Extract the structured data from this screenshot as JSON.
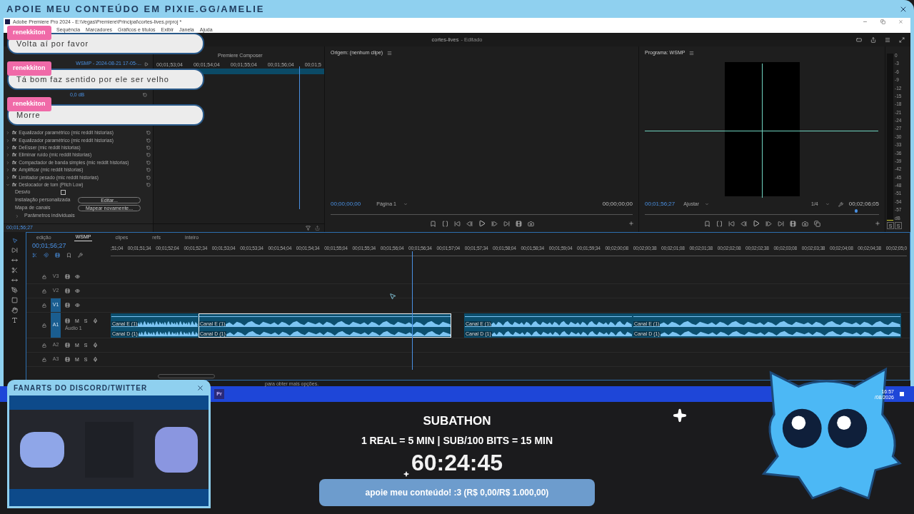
{
  "banner": {
    "title": "APOIE MEU CONTEÚDO EM PIXIE.GG/AMELIE"
  },
  "chat": [
    {
      "user": "renekkiton",
      "text": "Volta aí por favor"
    },
    {
      "user": "renekkiton",
      "text": "Tá bom faz sentido por ele ser velho"
    },
    {
      "user": "renekkiton",
      "text": "Morre"
    }
  ],
  "premiere": {
    "title": "Adobe Premiere Pro 2024 - E:\\Vegas\\Premiere\\Principal\\cortes-lives.prproj *",
    "menu": [
      "Sequência",
      "Marcadores",
      "Gráficos e títulos",
      "Exibir",
      "Janela",
      "Ajuda"
    ],
    "project_title": "cortes-lives",
    "project_state": "- Editado",
    "effect_controls": {
      "value": "0,0 dB",
      "effects": [
        {
          "fx": "fx",
          "name": "Equalizador paramétrico (mic reddit historias)",
          "expanded": false
        },
        {
          "fx": "fx",
          "name": "Equalizador paramétrico (mic reddit historias)",
          "expanded": false
        },
        {
          "fx": "fx",
          "name": "DeEsser (mic reddit historias)",
          "expanded": false
        },
        {
          "fx": "fx",
          "name": "Eliminar ruído (mic reddit historias)",
          "expanded": false
        },
        {
          "fx": "fx",
          "name": "Compactador de banda simples (mic reddit historias)",
          "expanded": false
        },
        {
          "fx": "fx",
          "name": "Amplificar (mic reddit historias)",
          "expanded": false
        },
        {
          "fx": "fx",
          "name": "Limitador pesado (mic reddit historias)",
          "expanded": false
        },
        {
          "fx": "fx",
          "name": "Deslocador de tom (Pitch Low)",
          "expanded": true
        }
      ],
      "params": [
        {
          "kind": "checkbox",
          "label": "Desvio",
          "checked": false
        },
        {
          "kind": "button",
          "label": "Instalação personalizada",
          "button": "Editar..."
        },
        {
          "kind": "button",
          "label": "Mapa de canais",
          "button": "Mapear novamente..."
        },
        {
          "kind": "group",
          "label": "Parâmetros individuais"
        }
      ],
      "timecode": "00;01;56;27"
    },
    "composer": {
      "tab": "Premiere Composer",
      "sequence": "WSMP - 2024-08-21 17-05-...",
      "ruler": [
        "00;01;53;04",
        "00;01;54;04",
        "00;01;55;04",
        "00;01;56;04",
        "00;01;5"
      ]
    },
    "source": {
      "title": "Origem: (nenhum clipe)",
      "timecode": "00;00;00;00",
      "page": "Página 1",
      "duration": "00;00;00;00"
    },
    "program": {
      "title": "Programa: WSMP",
      "timecode": "00;01;56;27",
      "zoom": "Ajustar",
      "resolution": "1/4",
      "duration": "00;02;06;05"
    },
    "meter": {
      "scale": [
        "0",
        "-3",
        "-6",
        "-9",
        "-12",
        "-15",
        "-18",
        "-21",
        "-24",
        "-27",
        "-30",
        "-33",
        "-36",
        "-39",
        "-42",
        "-45",
        "-48",
        "-51",
        "-54",
        "-57",
        "dB"
      ],
      "solo": [
        "S",
        "S"
      ]
    },
    "timeline": {
      "tabs": [
        {
          "label": "edição",
          "selected": false
        },
        {
          "label": "WSMP",
          "selected": true
        },
        {
          "label": "clipes",
          "selected": false
        },
        {
          "label": "refs",
          "selected": false
        },
        {
          "label": "inteiro",
          "selected": false
        }
      ],
      "timecode": "00;01;56;27",
      "ruler": [
        ";51;04",
        "00;01;51;34",
        "00;01;52;04",
        "00;01;52;34",
        "00;01;53;04",
        "00;01;53;34",
        "00;01;54;04",
        "00;01;54;34",
        "00;01;55;04",
        "00;01;55;34",
        "00;01;56;04",
        "00;01;56;34",
        "00;01;57;04",
        "00;01;57;34",
        "00;01;58;04",
        "00;01;58;34",
        "00;01;59;04",
        "00;01;59;34",
        "00;02;00;08",
        "00;02;00;38",
        "00;02;01;08",
        "00;02;01;38",
        "00;02;02;08",
        "00;02;02;38",
        "00;02;03;08",
        "00;02;03;38",
        "00;02;04;08",
        "00;02;04;38",
        "00;02;05;0"
      ],
      "tracks": [
        {
          "name": "V3",
          "kind": "video",
          "selected": false
        },
        {
          "name": "V2",
          "kind": "video",
          "selected": false
        },
        {
          "name": "V1",
          "kind": "video",
          "selected": true
        },
        {
          "name": "A1",
          "kind": "audio",
          "selected": true,
          "label": "Áudio 1",
          "buttons": [
            "M",
            "S"
          ]
        },
        {
          "name": "A2",
          "kind": "audio",
          "selected": false,
          "buttons": [
            "M",
            "S"
          ]
        },
        {
          "name": "A3",
          "kind": "audio",
          "selected": false,
          "buttons": [
            "M",
            "S"
          ]
        }
      ],
      "clips": [
        {
          "labels": [
            "Canal E (1)",
            "Canal D (1)"
          ],
          "selected": false
        },
        {
          "labels": [
            "Canal E (1)",
            "Canal D (1)"
          ],
          "selected": true
        },
        {
          "labels": [
            "Canal E (1)",
            "Canal D (1)"
          ],
          "selected": false
        },
        {
          "labels": [
            "Canal E (1)",
            "Canal D (1)"
          ],
          "selected": false
        }
      ]
    },
    "status": "para obter mais opções."
  },
  "taskbar": {
    "app": "Pr",
    "time": "16:57",
    "date": "/08/2026"
  },
  "fanart": {
    "title": "FANARTS DO DISCORD/TWITTER"
  },
  "subathon": {
    "title": "SUBATHON",
    "rates": "1 REAL = 5 MIN | SUB/100 BITS = 15 MIN",
    "timer": "60:24:45",
    "goal": {
      "label": "apoie meu conteúdo! :3 (R$ 0,00/R$ 1.000,00)",
      "level": 0
    }
  }
}
